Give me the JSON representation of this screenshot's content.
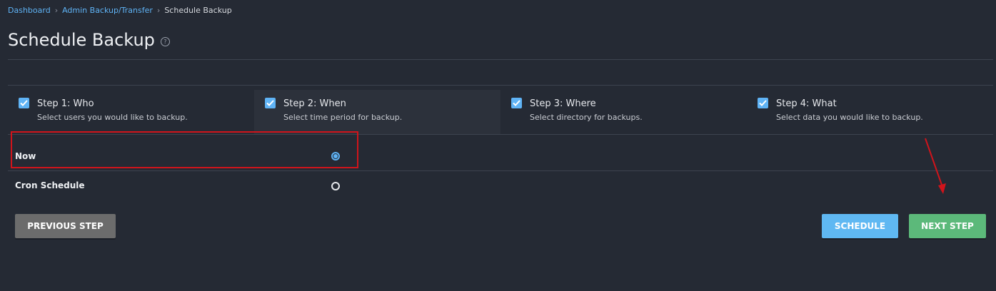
{
  "breadcrumb": {
    "items": [
      "Dashboard",
      "Admin Backup/Transfer",
      "Schedule Backup"
    ]
  },
  "page": {
    "title": "Schedule Backup",
    "help_icon": "?"
  },
  "steps": [
    {
      "title": "Step 1: Who",
      "desc": "Select users you would like to backup.",
      "checked": true
    },
    {
      "title": "Step 2: When",
      "desc": "Select time period for backup.",
      "checked": true
    },
    {
      "title": "Step 3: Where",
      "desc": "Select directory for backups.",
      "checked": true
    },
    {
      "title": "Step 4: What",
      "desc": "Select data you would like to backup.",
      "checked": true
    }
  ],
  "options": {
    "now_label": "Now",
    "now_selected": true,
    "cron_label": "Cron Schedule",
    "cron_selected": false
  },
  "buttons": {
    "previous": "PREVIOUS STEP",
    "schedule": "SCHEDULE",
    "next": "NEXT STEP"
  },
  "colors": {
    "background": "#252a34",
    "accent_blue": "#5fb3f5",
    "highlight_red": "#d0141b",
    "next_green": "#5cb97a",
    "prev_gray": "#6c6c6c"
  }
}
